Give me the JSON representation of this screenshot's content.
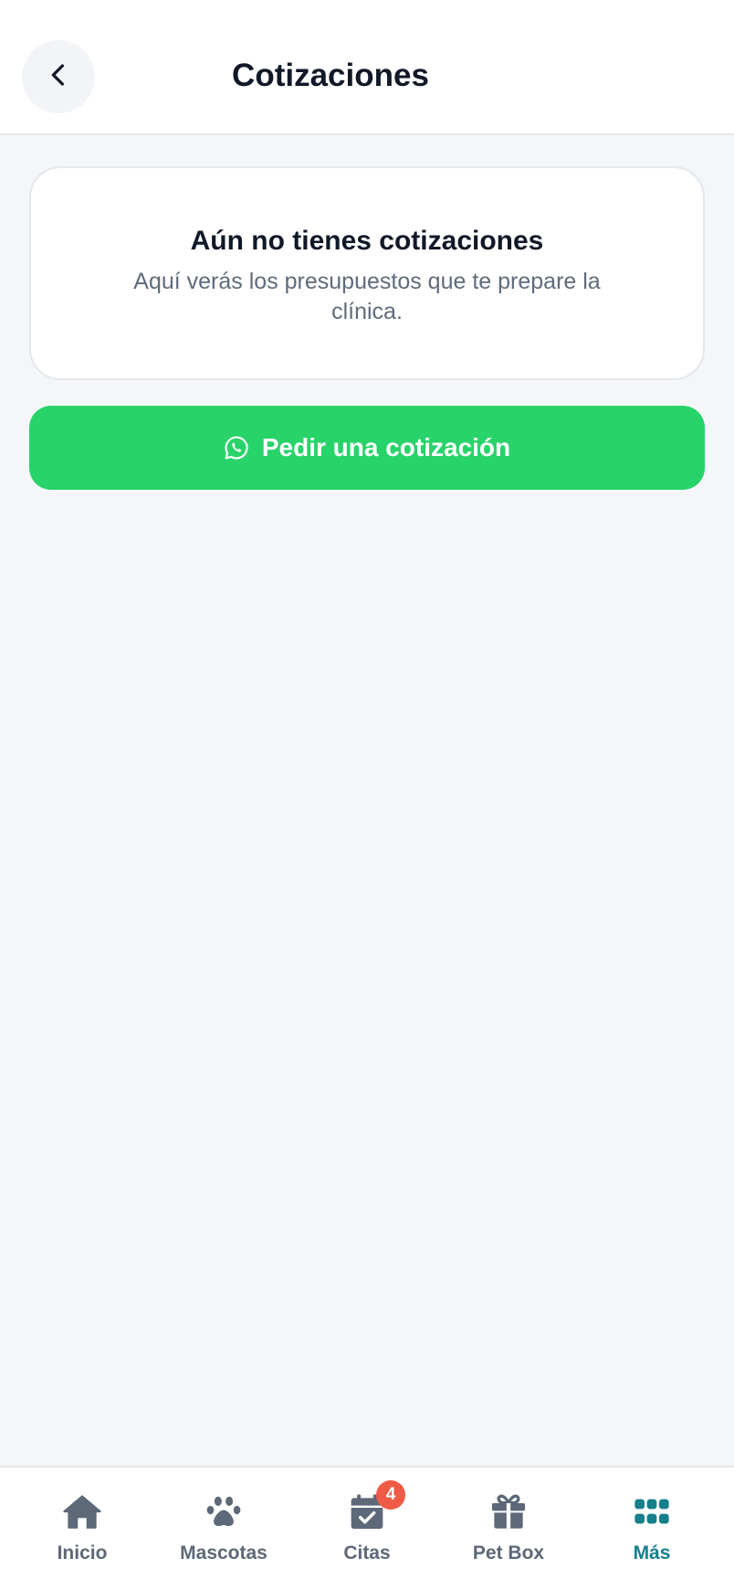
{
  "header": {
    "title": "Cotizaciones",
    "back_icon": "chevron-left-icon"
  },
  "empty_state": {
    "title": "Aún no tienes cotizaciones",
    "description": "Aquí verás los presupuestos que te prepare la clínica."
  },
  "cta": {
    "label": "Pedir una cotización",
    "icon": "whatsapp-icon",
    "color": "#28d36a"
  },
  "tabbar": {
    "active_color": "#157f8c",
    "items": [
      {
        "label": "Inicio",
        "icon": "home-icon"
      },
      {
        "label": "Mascotas",
        "icon": "paw-icon"
      },
      {
        "label": "Citas",
        "icon": "calendar-check-icon",
        "badge": "4"
      },
      {
        "label": "Pet Box",
        "icon": "gift-icon"
      },
      {
        "label": "Más",
        "icon": "grid-dots-icon",
        "active": true
      }
    ]
  }
}
